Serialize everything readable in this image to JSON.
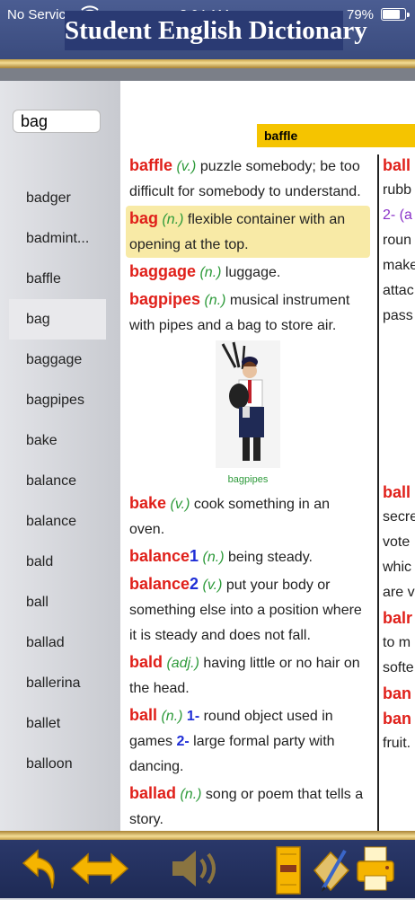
{
  "status": {
    "carrier": "No Service",
    "time": "8:04 AM",
    "battery": "79%"
  },
  "app_title": "Student English Dictionary",
  "search": {
    "value": "bag"
  },
  "word_list": [
    "badger",
    "badmint...",
    "baffle",
    "bag",
    "baggage",
    "bagpipes",
    "bake",
    "balance",
    "balance",
    "bald",
    "ball",
    "ballad",
    "ballerina",
    "ballet",
    "balloon"
  ],
  "selected_word": "bag",
  "header_word": "baffle",
  "entries": {
    "baffle": {
      "hw": "baffle",
      "pos": "(v.)",
      "def": " puzzle somebody; be too difficult for somebody to understand."
    },
    "bag": {
      "hw": "bag",
      "pos": "(n.)",
      "def": " flexible container with an opening at the top."
    },
    "baggage": {
      "hw": "baggage",
      "pos": "(n.)",
      "def": " luggage."
    },
    "bagpipes": {
      "hw": "bagpipes",
      "pos": "(n.)",
      "def": " musical instrument with pipes and a bag to store air."
    },
    "bake": {
      "hw": "bake",
      "pos": "(v.)",
      "def": " cook something in an oven."
    },
    "balance1": {
      "hw": "balance",
      "n": "1",
      "pos": "(n.)",
      "def": " being steady."
    },
    "balance2": {
      "hw": "balance",
      "n": "2",
      "pos": "(v.)",
      "def": " put your body or something else into a position where it is steady and does not fall."
    },
    "bald": {
      "hw": "bald",
      "pos": "(adj.)",
      "def": " having little or no hair on the head."
    },
    "ball": {
      "hw": "ball",
      "pos": "(n.)",
      "n1": "1-",
      "def1": " round object used in games ",
      "n2": "2-",
      "def2": " large formal party with dancing."
    },
    "ballad": {
      "hw": "ballad",
      "pos": "(n.)",
      "def": " song or poem that tells a story."
    }
  },
  "figure_caption": "bagpipes",
  "right_column": [
    "ball",
    "rubb",
    "2- (a",
    "roun",
    "make",
    "attac",
    "pass",
    "ball",
    "secre",
    "vote",
    "whic",
    "are v",
    "balr",
    "to m",
    "softe",
    "ban",
    "ban",
    "fruit."
  ]
}
